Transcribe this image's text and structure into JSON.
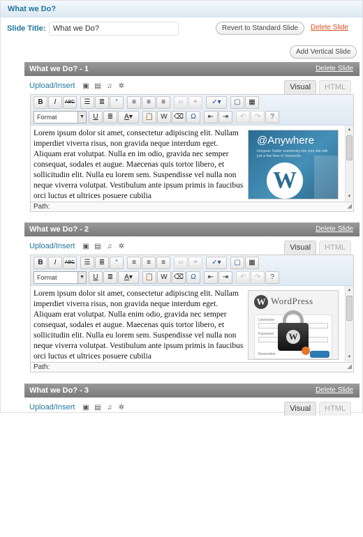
{
  "section": {
    "title": "What we Do?"
  },
  "slide_title": {
    "label": "Slide Title:",
    "value": "What we Do?"
  },
  "actions": {
    "revert_label": "Revert to Standard Slide",
    "delete_label": "Delete Slide",
    "add_vertical_label": "Add Vertical Slide"
  },
  "slides": [
    {
      "header": "What we Do? - 1",
      "delete_label": "Delete Slide",
      "upload_label": "Upload/Insert",
      "tabs": [
        "Visual",
        "HTML"
      ],
      "format_value": "Format",
      "content": "Lorem ipsum dolor sit amet, consectetur adipiscing elit. Nullam imperdiet viverra risus, non gravida neque interdum eget. Aliquam erat volutpat. Nulla en im odio, gravida nec semper consequat, sodales et augue. Maecenas quis tortor libero, et sollicitudin elit. Nulla eu lorem sem. Suspendisse vel nulla non neque viverra volutpat. Vestibulum ante ipsum primis in faucibus orci luctus et ultrices posuere cubilia",
      "image": {
        "title": "@Anywhere",
        "subtitle": "Integrate Twitter seamlessly into your site with just a few lines of Javascript."
      },
      "path_label": "Path:"
    },
    {
      "header": "What we Do? - 2",
      "delete_label": "Delete Slide",
      "upload_label": "Upload/Insert",
      "tabs": [
        "Visual",
        "HTML"
      ],
      "format_value": "Format",
      "content": "Lorem ipsum dolor sit amet, consectetur adipiscing elit. Nullam imperdiet viverra risus, non gravida neque interdum eget. Aliquam erat volutpat. Nulla enim odio, gravida nec semper consequat, sodales et augue. Maecenas quis tortor libero, et sollicitudin elit. Nulla eu lorem sem. Suspendisse vel nulla non neque viverra volutpat. Vestibulum ante ipsum primis in faucibus orci luctus et ultrices posuere cubilia",
      "image": {
        "title": "WordPress",
        "username_label": "Username",
        "password_label": "Password",
        "remember_label": "Remember"
      },
      "path_label": "Path:"
    },
    {
      "header": "What we Do? - 3",
      "delete_label": "Delete Slide",
      "upload_label": "Upload/Insert",
      "tabs": [
        "Visual",
        "HTML"
      ]
    }
  ],
  "toolbar_icons": {
    "row1": [
      "bold-icon",
      "italic-icon",
      "strikethrough-icon",
      "bullet-list-icon",
      "numbered-list-icon",
      "blockquote-icon",
      "align-left-icon",
      "align-center-icon",
      "align-right-icon",
      "link-icon",
      "unlink-icon",
      "spellcheck-icon",
      "fullscreen-icon",
      "kitchen-sink-icon"
    ],
    "row2": [
      "format-select",
      "underline-icon",
      "justify-icon",
      "text-color-icon",
      "paste-text-icon",
      "paste-word-icon",
      "remove-format-icon",
      "special-char-icon",
      "outdent-icon",
      "indent-icon",
      "undo-icon",
      "redo-icon",
      "help-icon"
    ]
  },
  "colors": {
    "accent": "#21759b",
    "danger": "#d54e21",
    "slide_header": "#8a8a8a"
  }
}
